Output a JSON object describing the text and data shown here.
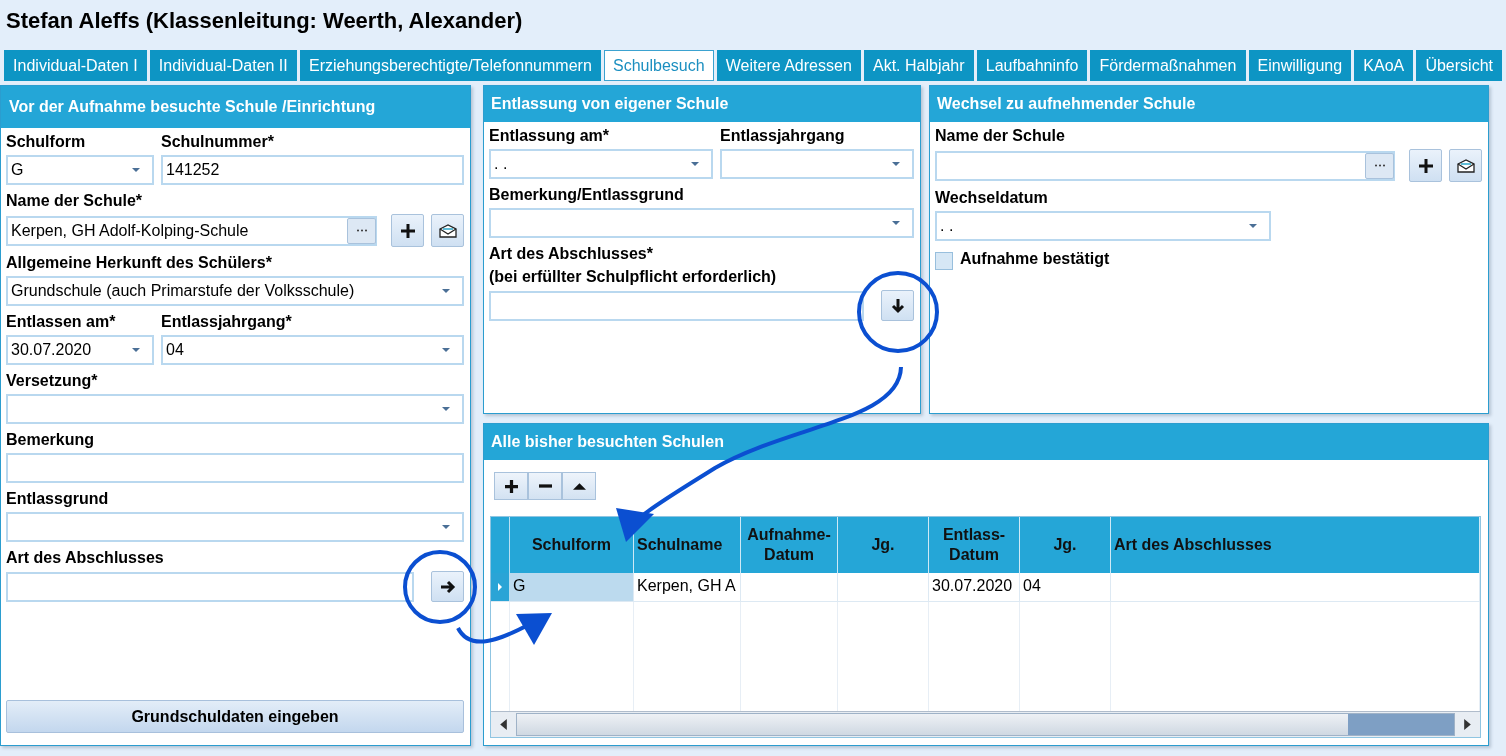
{
  "title": "Stefan Aleffs (Klassenleitung: Weerth, Alexander)",
  "tabs": [
    {
      "label": "Individual-Daten I",
      "selected": false
    },
    {
      "label": "Individual-Daten II",
      "selected": false
    },
    {
      "label": "Erziehungsberechtigte/Telefonnummern",
      "selected": false
    },
    {
      "label": "Schulbesuch",
      "selected": true
    },
    {
      "label": "Weitere Adressen",
      "selected": false
    },
    {
      "label": "Akt. Halbjahr",
      "selected": false
    },
    {
      "label": "Laufbahninfo",
      "selected": false
    },
    {
      "label": "Fördermaßnahmen",
      "selected": false
    },
    {
      "label": "Einwilligung",
      "selected": false
    },
    {
      "label": "KAoA",
      "selected": false
    },
    {
      "label": "Übersicht",
      "selected": false
    }
  ],
  "panels": [
    {
      "title": "Vor der Aufnahme besuchte Schule /Einrichtung",
      "rows": [
        [
          {
            "label": "Schulform",
            "kind": "combo",
            "value": "G"
          },
          {
            "label": "Schulnummer*",
            "kind": "text",
            "value": "141252"
          }
        ],
        [
          {
            "label": "Name der Schule*",
            "kind": "lookup",
            "value": "Kerpen, GH Adolf-Kolping-Schule"
          }
        ],
        [
          {
            "label": "Allgemeine Herkunft des Schülers*",
            "kind": "combo",
            "value": "Grundschule (auch Primarstufe der Volksschule)"
          }
        ],
        [
          {
            "label": "Entlassen am*",
            "kind": "combo",
            "value": "30.07.2020"
          },
          {
            "label": "Entlassjahrgang*",
            "kind": "combo",
            "value": "04"
          }
        ],
        [
          {
            "label": "Versetzung*",
            "kind": "combo"
          }
        ],
        [
          {
            "label": "Bemerkung",
            "kind": "text"
          }
        ],
        [
          {
            "label": "Entlassgrund",
            "kind": "combo"
          }
        ],
        [
          {
            "label": "Art des Abschlusses",
            "kind": "forward"
          }
        ]
      ],
      "button": "Grundschuldaten eingeben"
    },
    {
      "title": "Entlassung von eigener Schule",
      "rows": [
        [
          {
            "label": "Entlassung am*",
            "kind": "combo",
            "value": ". ."
          },
          {
            "label": "Entlassjahrgang",
            "kind": "combo"
          }
        ],
        [
          {
            "label": "Bemerkung/Entlassgrund",
            "kind": "combo"
          }
        ],
        [
          {
            "label": "Art des Abschlusses*",
            "note": "(bei erfüllter Schulpflicht erforderlich)",
            "kind": "downward"
          }
        ]
      ]
    },
    {
      "title": "Wechsel zu aufnehmender Schule",
      "rows": [
        [
          {
            "label": "Name der Schule",
            "kind": "lookup"
          }
        ],
        [
          {
            "label": "Wechseldatum",
            "kind": "combo",
            "value": ". ."
          }
        ],
        [
          {
            "label": "Aufnahme bestätigt",
            "kind": "checkbox",
            "checked": false
          }
        ]
      ]
    }
  ],
  "table_panel": {
    "title": "Alle bisher besuchten Schulen",
    "columns": [
      "Schulform",
      "Schulname",
      "Aufnahme-Datum",
      "Jg.",
      "Entlass-Datum",
      "Jg.",
      "Art des Abschlusses"
    ],
    "rows": [
      {
        "selected": true,
        "cells": [
          "G",
          "Kerpen, GH A",
          null,
          null,
          "30.07.2020",
          "04",
          null
        ]
      }
    ]
  }
}
